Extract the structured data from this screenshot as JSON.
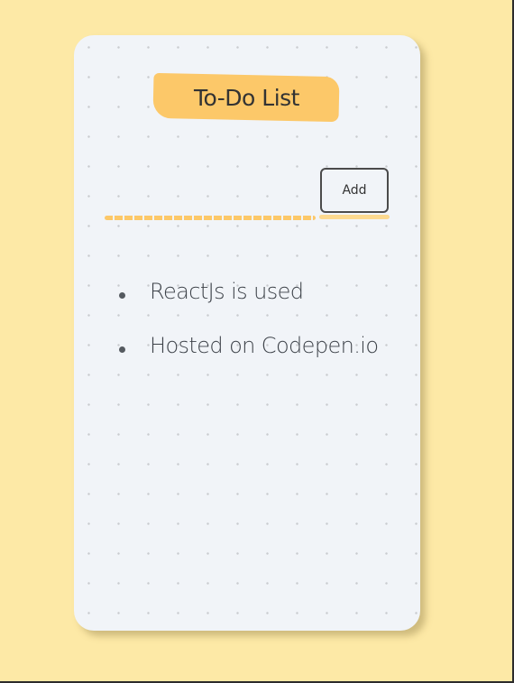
{
  "app": {
    "title": "To-Do List"
  },
  "form": {
    "input_value": "",
    "add_label": "Add"
  },
  "todos": [
    {
      "text": "ReactJs is used"
    },
    {
      "text": "Hosted on Codepen.io"
    }
  ],
  "colors": {
    "background": "#fde9a6",
    "card": "#f1f4f8",
    "accent": "#fcc869",
    "text": "#3d4249",
    "button_border": "#4b4b4b"
  }
}
